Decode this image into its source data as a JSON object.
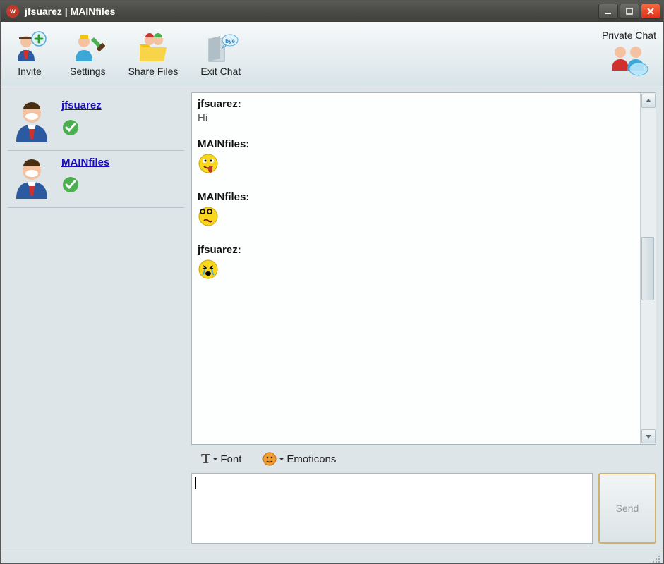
{
  "window": {
    "title": "jfsuarez | MAINfiles"
  },
  "toolbar": {
    "invite_label": "Invite",
    "settings_label": "Settings",
    "share_label": "Share Files",
    "exit_label": "Exit Chat",
    "private_chat_label": "Private Chat"
  },
  "sidebar": {
    "users": [
      {
        "name": "jfsuarez",
        "status": "online"
      },
      {
        "name": "MAINfiles",
        "status": "online"
      }
    ]
  },
  "chat": {
    "messages": [
      {
        "sender": "jfsuarez",
        "type": "text",
        "text": "Hi"
      },
      {
        "sender": "MAINfiles",
        "type": "emoji",
        "emoji": "silly-tongue"
      },
      {
        "sender": "MAINfiles",
        "type": "emoji",
        "emoji": "confused"
      },
      {
        "sender": "jfsuarez",
        "type": "emoji",
        "emoji": "crying"
      }
    ]
  },
  "format": {
    "font_label": "Font",
    "emoticons_label": "Emoticons"
  },
  "compose": {
    "value": "",
    "send_label": "Send"
  }
}
